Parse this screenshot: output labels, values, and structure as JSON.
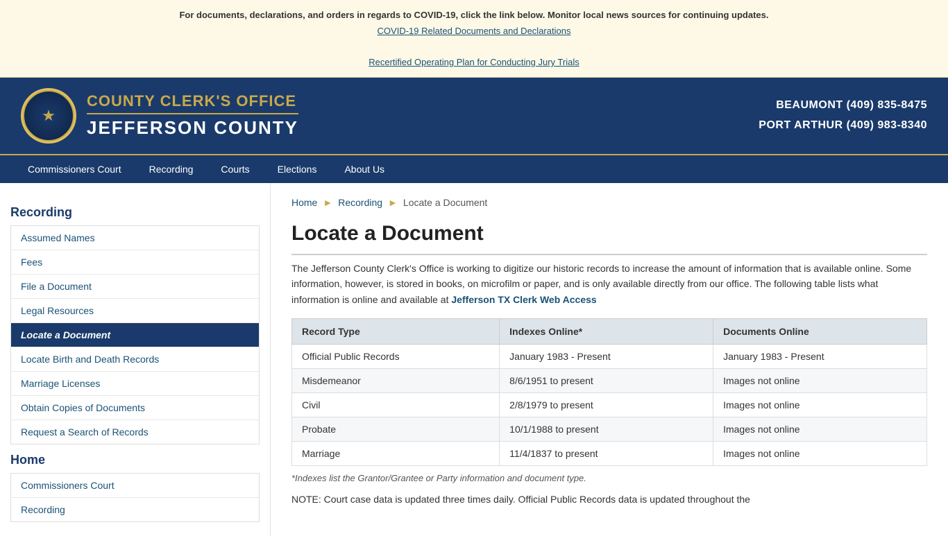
{
  "alert": {
    "bold_text": "For documents, declarations, and orders in regards to COVID-19, click the link below. Monitor local news sources for continuing updates.",
    "link1_text": "COVID-19 Related Documents and Declarations",
    "link2_text": "Recertified Operating Plan for Conducting Jury Trials"
  },
  "header": {
    "office_line": "COUNTY CLERK'S OFFICE",
    "county_line": "JEFFERSON COUNTY",
    "contact_line1": "BEAUMONT (409) 835-8475",
    "contact_line2": "PORT ARTHUR (409) 983-8340"
  },
  "nav": {
    "items": [
      {
        "label": "Commissioners Court"
      },
      {
        "label": "Recording"
      },
      {
        "label": "Courts"
      },
      {
        "label": "Elections"
      },
      {
        "label": "About Us"
      }
    ]
  },
  "sidebar": {
    "sections": [
      {
        "title": "Recording",
        "items": [
          {
            "label": "Assumed Names",
            "active": false
          },
          {
            "label": "Fees",
            "active": false
          },
          {
            "label": "File a Document",
            "active": false
          },
          {
            "label": "Legal Resources",
            "active": false
          },
          {
            "label": "Locate a Document",
            "active": true
          },
          {
            "label": "Locate Birth and Death Records",
            "active": false
          },
          {
            "label": "Marriage Licenses",
            "active": false
          },
          {
            "label": "Obtain Copies of Documents",
            "active": false
          },
          {
            "label": "Request a Search of Records",
            "active": false
          }
        ]
      },
      {
        "title": "Home",
        "items": [
          {
            "label": "Commissioners Court",
            "active": false
          },
          {
            "label": "Recording",
            "active": false
          }
        ]
      }
    ]
  },
  "breadcrumb": {
    "home": "Home",
    "section": "Recording",
    "current": "Locate a Document"
  },
  "main": {
    "page_title": "Locate a Document",
    "body_text": "The Jefferson County Clerk's Office is working to digitize our historic records to increase the amount of information that is available online. Some information, however, is stored in books, on microfilm or paper, and is only available directly from our office. The following table lists what information is online and available at",
    "link_text": "Jefferson TX Clerk Web Access",
    "table": {
      "headers": [
        "Record Type",
        "Indexes Online*",
        "Documents Online"
      ],
      "rows": [
        [
          "Official Public Records",
          "January 1983 - Present",
          "January 1983 - Present"
        ],
        [
          "Misdemeanor",
          "8/6/1951 to present",
          "Images not online"
        ],
        [
          "Civil",
          "2/8/1979 to present",
          "Images not online"
        ],
        [
          "Probate",
          "10/1/1988 to present",
          "Images not online"
        ],
        [
          "Marriage",
          "11/4/1837 to present",
          "Images not online"
        ]
      ]
    },
    "footnote": "*Indexes list the Grantor/Grantee or Party information and document type.",
    "note": "NOTE: Court case data is updated three times daily. Official Public Records data is updated throughout the"
  }
}
